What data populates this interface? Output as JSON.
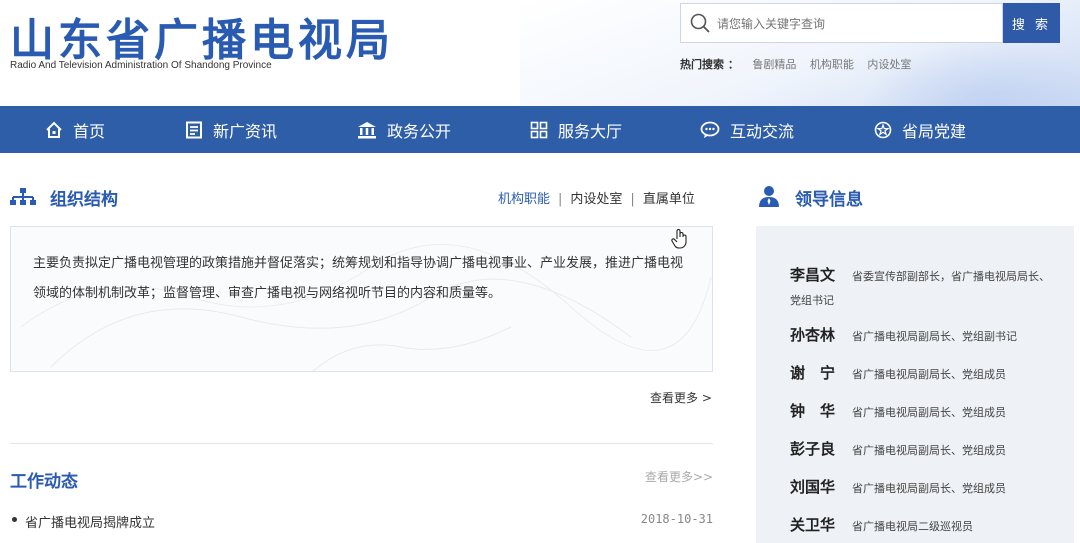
{
  "header": {
    "logo_cn": "山东省广播电视局",
    "logo_en": "Radio And Television Administration Of Shandong Province",
    "search": {
      "placeholder": "请您输入关键字查询",
      "button_label": "搜 索"
    },
    "hot_search": {
      "label": "热门搜索 ：",
      "items": [
        "鲁剧精品",
        "机构职能",
        "内设处室"
      ]
    }
  },
  "nav": {
    "items": [
      {
        "label": "首页",
        "icon": "home-icon"
      },
      {
        "label": "新广资讯",
        "icon": "news-icon"
      },
      {
        "label": "政务公开",
        "icon": "government-building-icon"
      },
      {
        "label": "服务大厅",
        "icon": "grid-icon"
      },
      {
        "label": "互动交流",
        "icon": "chat-icon"
      },
      {
        "label": "省局党建",
        "icon": "party-emblem-icon"
      }
    ]
  },
  "org": {
    "title": "组织结构",
    "icon": "org-chart-icon",
    "tabs": [
      "机构职能",
      "内设处室",
      "直属单位"
    ],
    "active_tab": "机构职能",
    "description": "主要负责拟定广播电视管理的政策措施并督促落实；统筹规划和指导协调广播电视事业、产业发展，推进广播电视领域的体制机制改革；监督管理、审查广播电视与网络视听节目的内容和质量等。",
    "more_label": "查看更多 >"
  },
  "news": {
    "title": "工作动态",
    "more_label": "查看更多>>",
    "items": [
      {
        "title": "省广播电视局揭牌成立",
        "date": "2018-10-31"
      }
    ]
  },
  "leaders": {
    "title": "领导信息",
    "icon": "leader-icon",
    "items": [
      {
        "name": "李昌文",
        "title": "省委宣传部副部长，省广播电视局局长、党组书记"
      },
      {
        "name": "孙杏林",
        "title": "省广播电视局副局长、党组副书记"
      },
      {
        "name": "谢　宁",
        "title": "省广播电视局副局长、党组成员"
      },
      {
        "name": "钟　华",
        "title": "省广播电视局副局长、党组成员"
      },
      {
        "name": "彭子良",
        "title": "省广播电视局副局长、党组成员"
      },
      {
        "name": "刘国华",
        "title": "省广播电视局副局长、党组成员"
      },
      {
        "name": "关卫华",
        "title": "省广播电视局二级巡视员"
      }
    ]
  },
  "colors": {
    "brand_blue": "#2f5ea9",
    "title_blue": "#2a5bb2",
    "panel_gray": "#eef1f5"
  }
}
